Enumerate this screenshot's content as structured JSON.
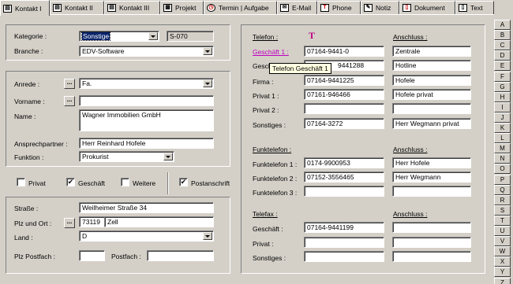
{
  "tabs": [
    {
      "label": "Kontakt I",
      "icon": "contact-card-icon"
    },
    {
      "label": "Kontakt II",
      "icon": "contact-card-icon"
    },
    {
      "label": "Kontakt III",
      "icon": "contact-card-icon"
    },
    {
      "label": "Projekt",
      "icon": "project-grid-icon"
    },
    {
      "label": "Termin | Aufgabe",
      "icon": "clock-icon"
    },
    {
      "label": "E-Mail",
      "icon": "mail-icon"
    },
    {
      "label": "Phone",
      "icon": "phone-icon"
    },
    {
      "label": "Notiz",
      "icon": "note-icon"
    },
    {
      "label": "Dokument",
      "icon": "document-icon"
    },
    {
      "label": "Text",
      "icon": "text-icon"
    }
  ],
  "alphabet": [
    "A",
    "B",
    "C",
    "D",
    "E",
    "F",
    "G",
    "H",
    "I",
    "J",
    "K",
    "L",
    "M",
    "N",
    "O",
    "P",
    "Q",
    "R",
    "S",
    "T",
    "U",
    "V",
    "W",
    "X",
    "Y",
    "Z"
  ],
  "left": {
    "kategorie_label": "Kategorie :",
    "kategorie_value": "Sonstige",
    "kategorie_code": "S-070",
    "branche_label": "Branche :",
    "branche_value": "EDV-Software",
    "anrede_label": "Anrede :",
    "anrede_value": "Fa.",
    "vorname_label": "Vorname :",
    "vorname_value": "",
    "name_label": "Name :",
    "name_value": "Wagner Immobilien GmbH",
    "ansprechpartner_label": "Ansprechpartner :",
    "ansprechpartner_value": "Herr Reinhard Hofele",
    "funktion_label": "Funktion :",
    "funktion_value": "Prokurist",
    "checks": {
      "privat_label": "Privat",
      "privat_checked": false,
      "geschaeft_label": "Geschäft",
      "geschaeft_checked": true,
      "weitere_label": "Weitere",
      "weitere_checked": false,
      "postanschrift_label": "Postanschrift",
      "postanschrift_checked": true
    },
    "strasse_label": "Straße :",
    "strasse_value": "Weilheimer Straße 34",
    "plzort_label": "Plz und Ort :",
    "plz_value": "73119",
    "ort_value": "Zell",
    "land_label": "Land :",
    "land_value": "D",
    "plzpostfach_label": "Plz Postfach :",
    "plzpostfach_value": "",
    "postfach_label": "Postfach :",
    "postfach_value": ""
  },
  "right": {
    "telefon_header": "Telefon :",
    "anschluss_header": "Anschluss :",
    "telefon_rows": [
      {
        "label": "Geschäft 1 :",
        "number": "07164-9441-0",
        "anschluss": "Zentrale"
      },
      {
        "label": "Gesch",
        "number": "9441288",
        "anschluss": "Hotline"
      },
      {
        "label": "Firma :",
        "number": "07164-9441225",
        "anschluss": "Hofele"
      },
      {
        "label": "Privat 1 :",
        "number": "07161-946466",
        "anschluss": "Hofele privat"
      },
      {
        "label": "Privat 2 :",
        "number": "",
        "anschluss": ""
      },
      {
        "label": "Sonstiges :",
        "number": "07164-3272",
        "anschluss": "Herr Wegmann privat"
      }
    ],
    "tooltip": "Telefon Geschäft 1",
    "funktelefon_header": "Funktelefon :",
    "funk_anschluss_header": "Anschluss :",
    "funk_rows": [
      {
        "label": "Funktelefon 1 :",
        "number": "0174-9900953",
        "anschluss": "Herr Hofele"
      },
      {
        "label": "Funktelefon 2 :",
        "number": "07152-3556465",
        "anschluss": "Herr Wegmann"
      },
      {
        "label": "Funktelefon 3 :",
        "number": "",
        "anschluss": ""
      }
    ],
    "telefax_header": "Telefax :",
    "fax_anschluss_header": "Anschluss :",
    "fax_rows": [
      {
        "label": "Geschäft :",
        "number": "07164-9441199",
        "anschluss": ""
      },
      {
        "label": "Privat :",
        "number": "",
        "anschluss": ""
      },
      {
        "label": "Sonstiges :",
        "number": "",
        "anschluss": ""
      }
    ]
  },
  "browse_button": "..."
}
